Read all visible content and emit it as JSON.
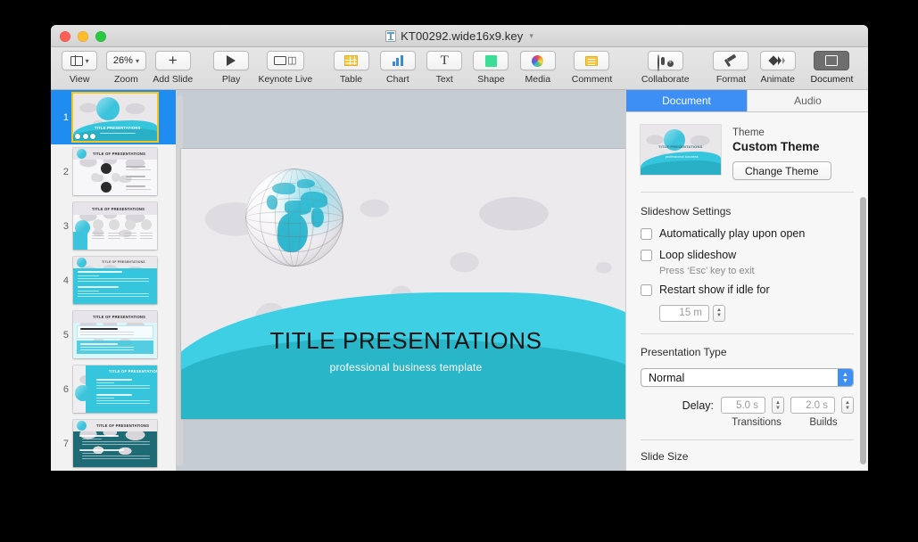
{
  "window": {
    "title": "KT00292.wide16x9.key",
    "traffic_lights": [
      "close",
      "minimize",
      "maximize"
    ]
  },
  "toolbar": {
    "items": [
      {
        "label": "View",
        "icon": "view-layout-icon",
        "value": "",
        "has_chevron": true,
        "selected": false
      },
      {
        "label": "Zoom",
        "icon": "zoom-icon",
        "value": "26%",
        "has_chevron": true,
        "selected": false
      },
      {
        "label": "Add Slide",
        "icon": "plus-icon",
        "value": "",
        "has_chevron": false,
        "selected": false
      },
      {
        "label": "Play",
        "icon": "play-icon",
        "value": "",
        "has_chevron": false,
        "selected": false
      },
      {
        "label": "Keynote Live",
        "icon": "keynote-live-icon",
        "value": "",
        "has_chevron": false,
        "selected": false
      },
      {
        "label": "Table",
        "icon": "table-icon",
        "value": "",
        "has_chevron": false,
        "selected": false
      },
      {
        "label": "Chart",
        "icon": "chart-icon",
        "value": "",
        "has_chevron": false,
        "selected": false
      },
      {
        "label": "Text",
        "icon": "text-icon",
        "value": "",
        "has_chevron": false,
        "selected": false
      },
      {
        "label": "Shape",
        "icon": "shape-icon",
        "value": "",
        "has_chevron": false,
        "selected": false
      },
      {
        "label": "Media",
        "icon": "media-icon",
        "value": "",
        "has_chevron": false,
        "selected": false
      },
      {
        "label": "Comment",
        "icon": "comment-icon",
        "value": "",
        "has_chevron": false,
        "selected": false
      },
      {
        "label": "Collaborate",
        "icon": "collaborate-icon",
        "value": "",
        "has_chevron": false,
        "selected": false
      },
      {
        "label": "Format",
        "icon": "format-brush-icon",
        "value": "",
        "has_chevron": false,
        "selected": false
      },
      {
        "label": "Animate",
        "icon": "animate-icon",
        "value": "",
        "has_chevron": false,
        "selected": false
      },
      {
        "label": "Document",
        "icon": "document-icon",
        "value": "",
        "has_chevron": false,
        "selected": true
      }
    ]
  },
  "navigator": {
    "slides": [
      {
        "number": "1",
        "selected": true,
        "layout": "title",
        "title": "TITLE PRESENTATIONS",
        "build_dots": 3
      },
      {
        "number": "2",
        "selected": false,
        "layout": "diagram",
        "title": "TITLE OF PRESENTATIONS",
        "build_dots": 0
      },
      {
        "number": "3",
        "selected": false,
        "layout": "four-circle",
        "title": "TITLE OF PRESENTATIONS",
        "build_dots": 0
      },
      {
        "number": "4",
        "selected": false,
        "layout": "teal-bullets",
        "title": "TITLE OF PRESENTATIONS",
        "build_dots": 0
      },
      {
        "number": "5",
        "selected": false,
        "layout": "light-panel",
        "title": "TITLE OF PRESENTATIONS",
        "build_dots": 0
      },
      {
        "number": "6",
        "selected": false,
        "layout": "teal-full",
        "title": "TITLE OF PRESENTATIONS",
        "build_dots": 0
      },
      {
        "number": "7",
        "selected": false,
        "layout": "dark-teal",
        "title": "TITLE OF PRESENTATIONS",
        "build_dots": 0
      }
    ]
  },
  "slide": {
    "title": "TITLE PRESENTATIONS",
    "subtitle": "professional business template",
    "zoom_level": "26%",
    "colors": {
      "wave_back": "#3ecfe4",
      "wave_front": "#2ab6c9",
      "globe_land": "#2fb7cf",
      "map_bg": "#edeaee",
      "canvas_bg": "#c5ccd4"
    }
  },
  "inspector": {
    "tabs": [
      {
        "label": "Document",
        "active": true
      },
      {
        "label": "Audio",
        "active": false
      }
    ],
    "theme": {
      "label": "Theme",
      "name": "Custom Theme",
      "change_button": "Change Theme"
    },
    "slideshow": {
      "heading": "Slideshow Settings",
      "options": [
        {
          "label": "Automatically play upon open",
          "checked": false,
          "sub": ""
        },
        {
          "label": "Loop slideshow",
          "checked": false,
          "sub": "Press ‘Esc’ key to exit"
        },
        {
          "label": "Restart show if idle for",
          "checked": false,
          "sub": ""
        }
      ],
      "idle_value": "15 m"
    },
    "presentation_type": {
      "heading": "Presentation Type",
      "selected": "Normal",
      "delay_label": "Delay:",
      "transitions_value": "5.0 s",
      "transitions_label": "Transitions",
      "builds_value": "2.0 s",
      "builds_label": "Builds"
    },
    "slide_size": {
      "heading": "Slide Size"
    },
    "accent_color": "#3d8ef5"
  }
}
